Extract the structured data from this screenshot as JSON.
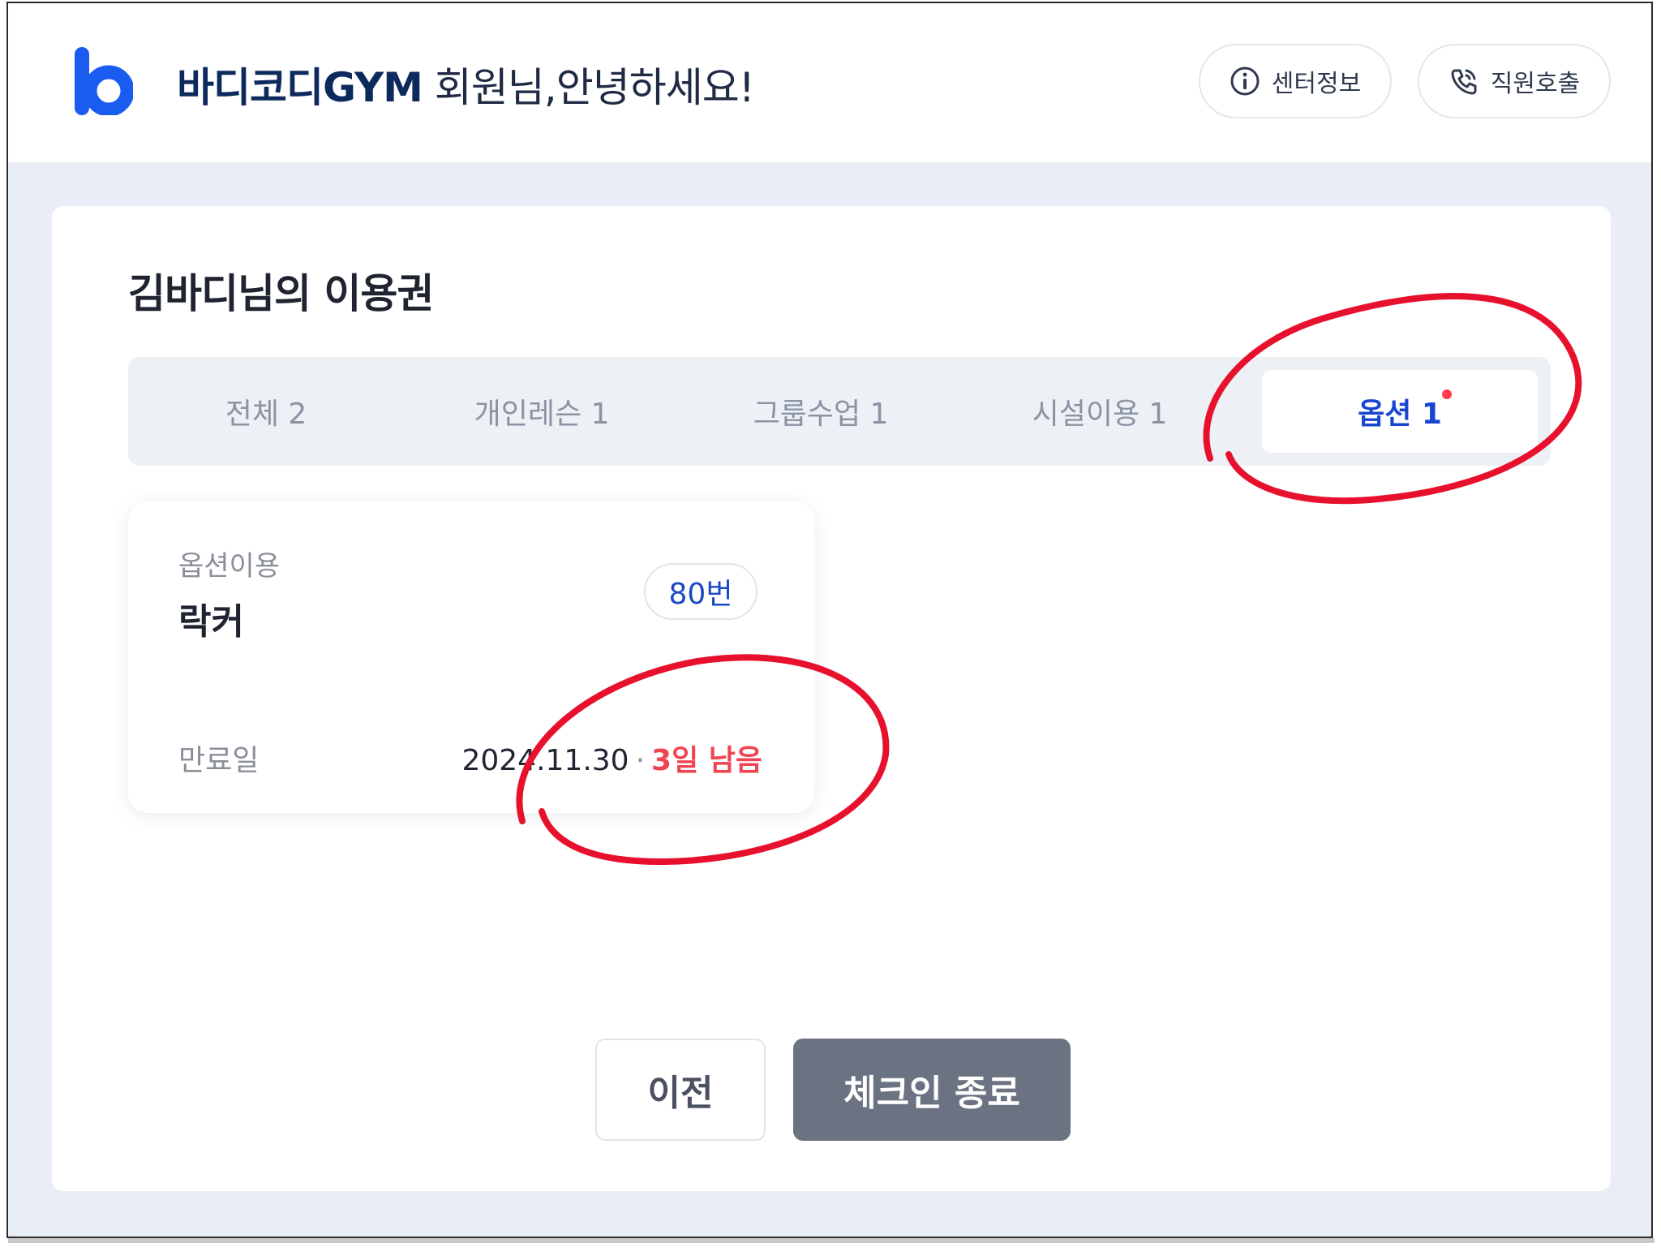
{
  "header": {
    "brand": "바디코디GYM",
    "greeting": " 회원님,안녕하세요!",
    "buttons": [
      {
        "label": "센터정보",
        "icon": "info-icon"
      },
      {
        "label": "직원호출",
        "icon": "phone-call-icon"
      }
    ]
  },
  "main": {
    "title": "김바디님의 이용권",
    "tabs": [
      {
        "label": "전체 2",
        "active": false
      },
      {
        "label": "개인레슨 1",
        "active": false
      },
      {
        "label": "그룹수업 1",
        "active": false
      },
      {
        "label": "시설이용 1",
        "active": false
      },
      {
        "label": "옵션 1",
        "active": true,
        "has_dot": true
      }
    ],
    "ticket": {
      "category": "옵션이용",
      "name": "락커",
      "badge": "80번",
      "expiry_label": "만료일",
      "expiry_date": "2024.11.30",
      "separator": "·",
      "remaining": "3일 남음"
    },
    "actions": {
      "prev_label": "이전",
      "end_label": "체크인 종료"
    }
  },
  "colors": {
    "accent_blue": "#1946d0",
    "alert_red": "#f04452",
    "annotation_red": "#e8112d",
    "button_gray": "#6b7383",
    "page_bg": "#e9edf5"
  }
}
